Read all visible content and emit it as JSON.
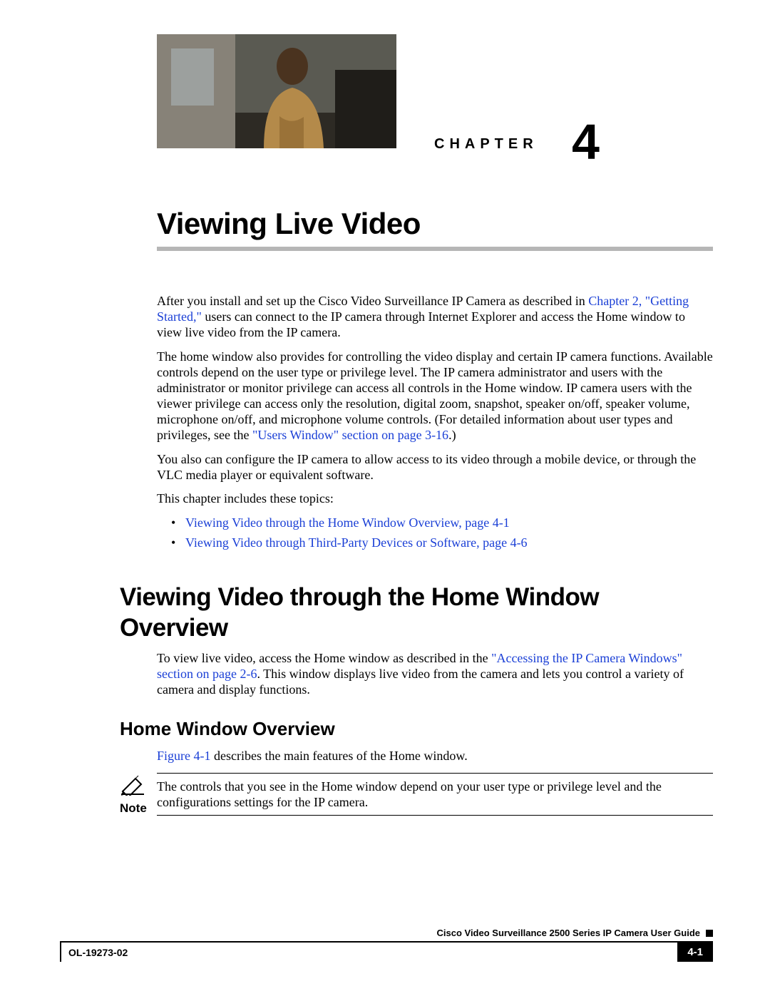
{
  "chapter": {
    "label": "CHAPTER",
    "number": "4"
  },
  "title": "Viewing Live Video",
  "intro": {
    "p1_a": "After you install and set up the Cisco Video Surveillance IP Camera as described in ",
    "p1_link": "Chapter 2, \"Getting Started,\"",
    "p1_b": " users can connect to the IP camera through Internet Explorer and access the Home window to view live video from the IP camera.",
    "p2_a": "The home window also provides for controlling the video display and certain IP camera functions. Available controls depend on the user type or privilege level. The IP camera administrator and users with the administrator or monitor privilege can access all controls in the Home window. IP camera users with the viewer privilege can access only the resolution, digital zoom, snapshot, speaker on/off, speaker volume, microphone on/off, and microphone volume controls. (For detailed information about user types and privileges, see the ",
    "p2_link": "\"Users Window\" section on page 3-16",
    "p2_b": ".)",
    "p3": "You also can configure the IP camera to allow access to its video through a mobile device, or through the VLC media player or equivalent software.",
    "p4": "This chapter includes these topics:",
    "bullet1": "Viewing Video through the Home Window Overview, page 4-1",
    "bullet2": "Viewing Video through Third-Party Devices or Software, page 4-6"
  },
  "section1": {
    "heading": "Viewing Video through the Home Window Overview",
    "p1_a": "To view live video, access the Home window as described in the ",
    "p1_link": "\"Accessing the IP Camera Windows\" section on page 2-6",
    "p1_b": ". This window displays live video from the camera and lets you control a variety of camera and display functions."
  },
  "section2": {
    "heading": "Home Window Overview",
    "p1_link": "Figure 4-1",
    "p1_b": " describes the main features of the Home window.",
    "note_label": "Note",
    "note_text": "The controls that you see in the Home window depend on your user type or privilege level and the configurations settings for the IP camera."
  },
  "footer": {
    "guide": "Cisco Video Surveillance 2500 Series IP Camera User Guide",
    "doc": "OL-19273-02",
    "page": "4-1"
  }
}
